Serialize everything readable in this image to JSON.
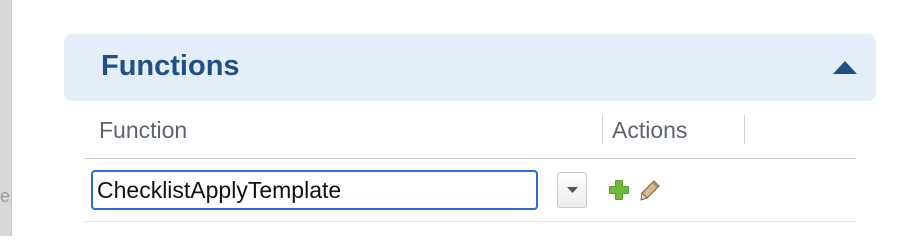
{
  "panel": {
    "title": "Functions",
    "collapsed": false
  },
  "table": {
    "columns": [
      "Function",
      "Actions"
    ],
    "rows": [
      {
        "function_value": "ChecklistApplyTemplate",
        "actions": [
          "add-icon",
          "edit-pencil-icon"
        ]
      }
    ]
  },
  "left_edge_glyph": "e",
  "colors": {
    "header_bg": "#e3eef9",
    "title": "#1e4f87",
    "focus_border": "#2b6cd4",
    "add_green": "#5aa12a"
  }
}
